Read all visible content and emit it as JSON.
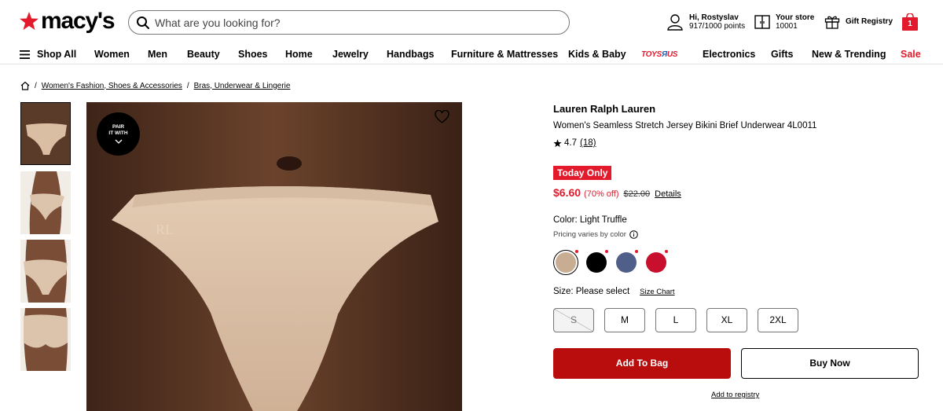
{
  "header": {
    "logo_text": "macy's",
    "search_placeholder": "What are you looking for?",
    "account_greeting": "Hi, Rostyslav",
    "account_points": "917/1000 points",
    "store_label": "Your store",
    "store_zip": "10001",
    "gift_registry": "Gift Registry",
    "bag_count": "1"
  },
  "nav": {
    "shop_all": "Shop All",
    "items": [
      "Women",
      "Men",
      "Beauty",
      "Shoes",
      "Home",
      "Jewelry",
      "Handbags",
      "Furniture & Mattresses",
      "Kids & Baby",
      "Electronics",
      "Gifts",
      "New & Trending",
      "Sale"
    ],
    "toys_logo": "TOYSЯUS"
  },
  "breadcrumb": {
    "items": [
      "Women's Fashion, Shoes & Accessories",
      "Bras, Underwear & Lingerie"
    ]
  },
  "gallery": {
    "pair_badge_line1": "PAIR",
    "pair_badge_line2": "IT WITH"
  },
  "product": {
    "brand": "Lauren Ralph Lauren",
    "name": "Women's Seamless Stretch Jersey Bikini Brief Underwear 4L0011",
    "rating": "4.7",
    "review_count": "(18)",
    "promo_badge": "Today Only",
    "sale_price": "$6.60",
    "discount": "(70% off)",
    "original_price": "$22.00",
    "details_link": "Details",
    "color_label": "Color: Light Truffle",
    "pricing_note": "Pricing varies by color",
    "swatches": [
      "#c9ad93",
      "#000000",
      "#4f5f8a",
      "#c8102e"
    ],
    "size_label": "Size: Please select",
    "size_chart": "Size Chart",
    "sizes": [
      "S",
      "M",
      "L",
      "XL",
      "2XL"
    ],
    "add_to_bag": "Add To Bag",
    "buy_now": "Buy Now",
    "add_to_registry": "Add to registry"
  },
  "colors": {
    "brand_red": "#e21a2c",
    "button_red": "#b90d0d"
  }
}
